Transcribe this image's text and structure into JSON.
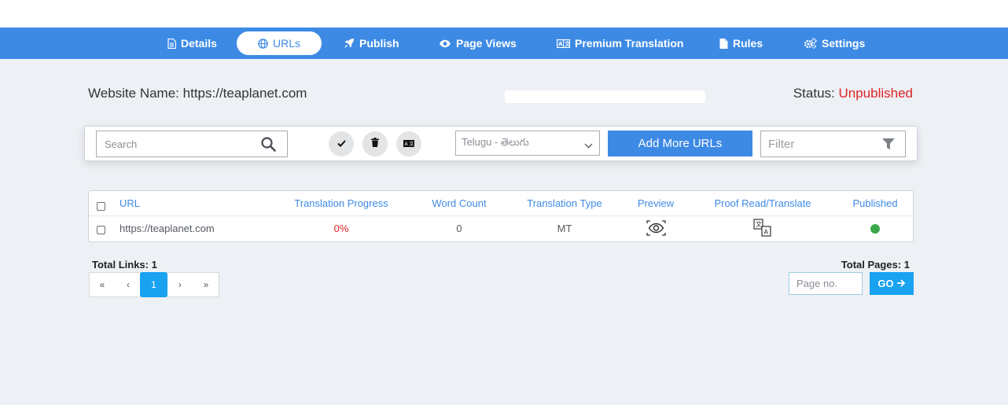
{
  "nav": {
    "tabs": [
      {
        "label": "Details",
        "icon": "document-icon"
      },
      {
        "label": "URLs",
        "icon": "globe-icon",
        "active": true
      },
      {
        "label": "Publish",
        "icon": "rocket-icon"
      },
      {
        "label": "Page Views",
        "icon": "eye-icon"
      },
      {
        "label": "Premium Translation",
        "icon": "translate-icon"
      },
      {
        "label": "Rules",
        "icon": "file-icon"
      },
      {
        "label": "Settings",
        "icon": "gears-icon"
      }
    ]
  },
  "site": {
    "name_label": "Website Name:",
    "name_value": "https://teaplanet.com",
    "status_label": "Status:",
    "status_value": "Unpublished"
  },
  "toolbar": {
    "search_placeholder": "Search",
    "language_selected": "Telugu - తెలుగు",
    "add_button": "Add More URLs",
    "filter_placeholder": "Filter"
  },
  "table": {
    "headers": {
      "url": "URL",
      "progress": "Translation Progress",
      "word_count": "Word Count",
      "type": "Translation Type",
      "preview": "Preview",
      "proof": "Proof Read/Translate",
      "published": "Published"
    },
    "rows": [
      {
        "url": "https://teaplanet.com",
        "progress": "0%",
        "word_count": "0",
        "type": "MT",
        "published": true
      }
    ]
  },
  "pagination": {
    "total_links": "Total Links: 1",
    "total_pages": "Total Pages: 1",
    "first": "«",
    "prev": "‹",
    "current": "1",
    "next": "›",
    "last": "»",
    "page_placeholder": "Page no.",
    "go_label": "GO"
  },
  "colors": {
    "primary": "#3d8ae5",
    "status_unpublished": "#e02424",
    "published_dot": "#3aa84a",
    "pager_active": "#19a2f0"
  }
}
